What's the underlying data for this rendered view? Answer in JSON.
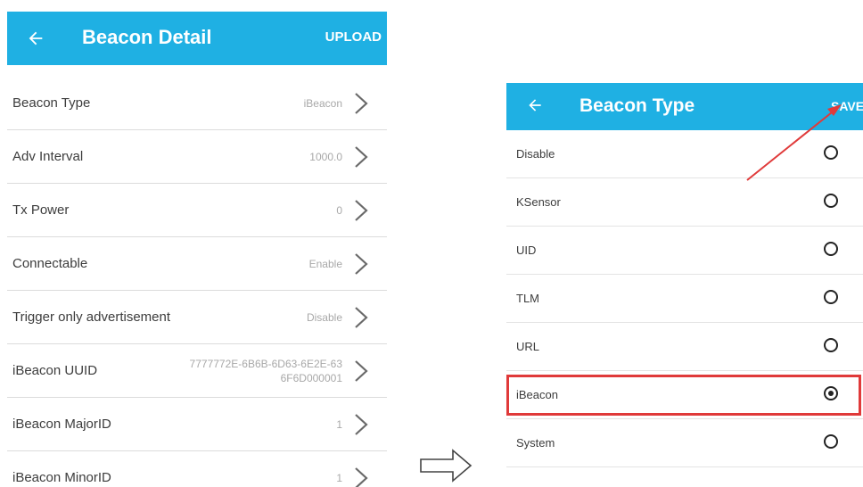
{
  "colors": {
    "accent": "#1fb0e3",
    "highlight": "#e03a3a"
  },
  "screen1": {
    "title": "Beacon Detail",
    "back_icon": "arrow-left-icon",
    "action": "UPLOAD",
    "rows": [
      {
        "label": "Beacon Type",
        "value": "iBeacon"
      },
      {
        "label": "Adv Interval",
        "value": "1000.0"
      },
      {
        "label": "Tx Power",
        "value": "0"
      },
      {
        "label": "Connectable",
        "value": "Enable"
      },
      {
        "label": "Trigger only advertisement",
        "value": "Disable"
      },
      {
        "label": "iBeacon UUID",
        "value": "7777772E-6B6B-6D63-6E2E-63 6F6D000001"
      },
      {
        "label": "iBeacon MajorID",
        "value": "1"
      },
      {
        "label": "iBeacon MinorID",
        "value": "1"
      }
    ]
  },
  "screen2": {
    "title": "Beacon Type",
    "back_icon": "arrow-left-icon",
    "action": "SAVE",
    "options": [
      {
        "label": "Disable",
        "selected": false
      },
      {
        "label": "KSensor",
        "selected": false
      },
      {
        "label": "UID",
        "selected": false
      },
      {
        "label": "TLM",
        "selected": false
      },
      {
        "label": "URL",
        "selected": false
      },
      {
        "label": "iBeacon",
        "selected": true
      },
      {
        "label": "System",
        "selected": false
      }
    ]
  },
  "flow_arrow_icon": "right-arrow-outline-icon"
}
